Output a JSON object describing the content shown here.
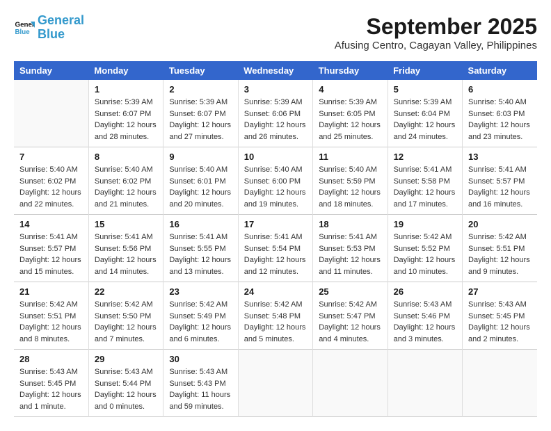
{
  "logo": {
    "line1": "General",
    "line2": "Blue"
  },
  "header": {
    "month": "September 2025",
    "location": "Afusing Centro, Cagayan Valley, Philippines"
  },
  "days": [
    "Sunday",
    "Monday",
    "Tuesday",
    "Wednesday",
    "Thursday",
    "Friday",
    "Saturday"
  ],
  "weeks": [
    [
      {
        "num": "",
        "info": ""
      },
      {
        "num": "1",
        "info": "Sunrise: 5:39 AM\nSunset: 6:07 PM\nDaylight: 12 hours\nand 28 minutes."
      },
      {
        "num": "2",
        "info": "Sunrise: 5:39 AM\nSunset: 6:07 PM\nDaylight: 12 hours\nand 27 minutes."
      },
      {
        "num": "3",
        "info": "Sunrise: 5:39 AM\nSunset: 6:06 PM\nDaylight: 12 hours\nand 26 minutes."
      },
      {
        "num": "4",
        "info": "Sunrise: 5:39 AM\nSunset: 6:05 PM\nDaylight: 12 hours\nand 25 minutes."
      },
      {
        "num": "5",
        "info": "Sunrise: 5:39 AM\nSunset: 6:04 PM\nDaylight: 12 hours\nand 24 minutes."
      },
      {
        "num": "6",
        "info": "Sunrise: 5:40 AM\nSunset: 6:03 PM\nDaylight: 12 hours\nand 23 minutes."
      }
    ],
    [
      {
        "num": "7",
        "info": "Sunrise: 5:40 AM\nSunset: 6:02 PM\nDaylight: 12 hours\nand 22 minutes."
      },
      {
        "num": "8",
        "info": "Sunrise: 5:40 AM\nSunset: 6:02 PM\nDaylight: 12 hours\nand 21 minutes."
      },
      {
        "num": "9",
        "info": "Sunrise: 5:40 AM\nSunset: 6:01 PM\nDaylight: 12 hours\nand 20 minutes."
      },
      {
        "num": "10",
        "info": "Sunrise: 5:40 AM\nSunset: 6:00 PM\nDaylight: 12 hours\nand 19 minutes."
      },
      {
        "num": "11",
        "info": "Sunrise: 5:40 AM\nSunset: 5:59 PM\nDaylight: 12 hours\nand 18 minutes."
      },
      {
        "num": "12",
        "info": "Sunrise: 5:41 AM\nSunset: 5:58 PM\nDaylight: 12 hours\nand 17 minutes."
      },
      {
        "num": "13",
        "info": "Sunrise: 5:41 AM\nSunset: 5:57 PM\nDaylight: 12 hours\nand 16 minutes."
      }
    ],
    [
      {
        "num": "14",
        "info": "Sunrise: 5:41 AM\nSunset: 5:57 PM\nDaylight: 12 hours\nand 15 minutes."
      },
      {
        "num": "15",
        "info": "Sunrise: 5:41 AM\nSunset: 5:56 PM\nDaylight: 12 hours\nand 14 minutes."
      },
      {
        "num": "16",
        "info": "Sunrise: 5:41 AM\nSunset: 5:55 PM\nDaylight: 12 hours\nand 13 minutes."
      },
      {
        "num": "17",
        "info": "Sunrise: 5:41 AM\nSunset: 5:54 PM\nDaylight: 12 hours\nand 12 minutes."
      },
      {
        "num": "18",
        "info": "Sunrise: 5:41 AM\nSunset: 5:53 PM\nDaylight: 12 hours\nand 11 minutes."
      },
      {
        "num": "19",
        "info": "Sunrise: 5:42 AM\nSunset: 5:52 PM\nDaylight: 12 hours\nand 10 minutes."
      },
      {
        "num": "20",
        "info": "Sunrise: 5:42 AM\nSunset: 5:51 PM\nDaylight: 12 hours\nand 9 minutes."
      }
    ],
    [
      {
        "num": "21",
        "info": "Sunrise: 5:42 AM\nSunset: 5:51 PM\nDaylight: 12 hours\nand 8 minutes."
      },
      {
        "num": "22",
        "info": "Sunrise: 5:42 AM\nSunset: 5:50 PM\nDaylight: 12 hours\nand 7 minutes."
      },
      {
        "num": "23",
        "info": "Sunrise: 5:42 AM\nSunset: 5:49 PM\nDaylight: 12 hours\nand 6 minutes."
      },
      {
        "num": "24",
        "info": "Sunrise: 5:42 AM\nSunset: 5:48 PM\nDaylight: 12 hours\nand 5 minutes."
      },
      {
        "num": "25",
        "info": "Sunrise: 5:42 AM\nSunset: 5:47 PM\nDaylight: 12 hours\nand 4 minutes."
      },
      {
        "num": "26",
        "info": "Sunrise: 5:43 AM\nSunset: 5:46 PM\nDaylight: 12 hours\nand 3 minutes."
      },
      {
        "num": "27",
        "info": "Sunrise: 5:43 AM\nSunset: 5:45 PM\nDaylight: 12 hours\nand 2 minutes."
      }
    ],
    [
      {
        "num": "28",
        "info": "Sunrise: 5:43 AM\nSunset: 5:45 PM\nDaylight: 12 hours\nand 1 minute."
      },
      {
        "num": "29",
        "info": "Sunrise: 5:43 AM\nSunset: 5:44 PM\nDaylight: 12 hours\nand 0 minutes."
      },
      {
        "num": "30",
        "info": "Sunrise: 5:43 AM\nSunset: 5:43 PM\nDaylight: 11 hours\nand 59 minutes."
      },
      {
        "num": "",
        "info": ""
      },
      {
        "num": "",
        "info": ""
      },
      {
        "num": "",
        "info": ""
      },
      {
        "num": "",
        "info": ""
      }
    ]
  ]
}
